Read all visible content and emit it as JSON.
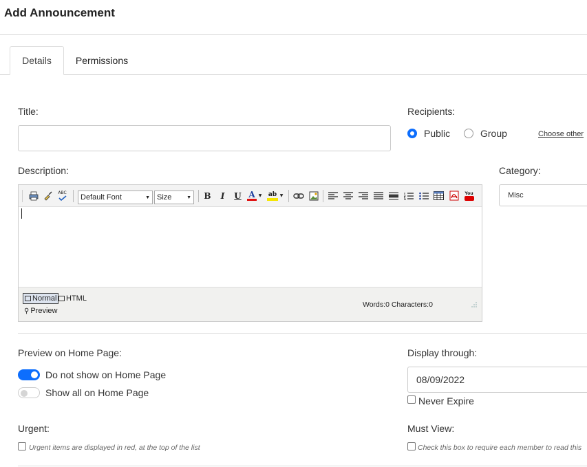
{
  "page": {
    "title": "Add Announcement"
  },
  "tabs": [
    {
      "label": "Details",
      "active": true
    },
    {
      "label": "Permissions",
      "active": false
    }
  ],
  "form": {
    "title_label": "Title:",
    "title_value": "",
    "recipients": {
      "label": "Recipients:",
      "options": [
        "Public",
        "Group"
      ],
      "selected": "Public",
      "choose_other_link": "Choose other"
    },
    "description_label": "Description:",
    "category": {
      "label": "Category:",
      "value": "Misc"
    },
    "editor": {
      "font_select": "Default Font",
      "size_select": "Size",
      "modes": [
        "Normal",
        "HTML"
      ],
      "preview": "Preview",
      "stats": "Words:0 Characters:0",
      "bold_glyph": "B",
      "italic_glyph": "I",
      "underline_glyph": "U",
      "font_color_glyph": "A",
      "highlight_glyph": "ab",
      "spell_glyph": "ABC",
      "youtube_glyph": "You"
    },
    "preview_home": {
      "label": "Preview on Home Page:",
      "options": [
        {
          "label": "Do not show on Home Page",
          "on": true
        },
        {
          "label": "Show all on Home Page",
          "on": false
        }
      ]
    },
    "display_through": {
      "label": "Display through:",
      "value": "08/09/2022",
      "never_expire": "Never Expire"
    },
    "urgent": {
      "label": "Urgent:",
      "hint": "Urgent items are displayed in red, at the top of the list"
    },
    "must_view": {
      "label": "Must View:",
      "hint": "Check this box to require each member to read this"
    }
  },
  "colors": {
    "accent": "#0d6efd",
    "border": "#cccccc",
    "toolbar": "#f3f3f3"
  }
}
